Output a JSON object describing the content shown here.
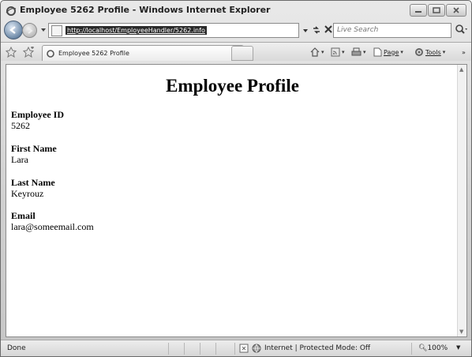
{
  "window": {
    "title": "Employee 5262 Profile - Windows Internet Explorer"
  },
  "address_bar": {
    "url": "http://localhost/EmployeeHandler/5262.info",
    "search_placeholder": "Live Search"
  },
  "tabs": [
    {
      "label": "Employee 5262 Profile"
    }
  ],
  "command_bar": {
    "page_label": "Page",
    "tools_label": "Tools"
  },
  "page": {
    "heading": "Employee Profile",
    "fields": [
      {
        "label": "Employee ID",
        "value": "5262"
      },
      {
        "label": "First Name",
        "value": "Lara"
      },
      {
        "label": "Last Name",
        "value": "Keyrouz"
      },
      {
        "label": "Email",
        "value": "lara@someemail.com"
      }
    ]
  },
  "status_bar": {
    "status": "Done",
    "zone": "Internet | Protected Mode: Off",
    "zoom": "100%"
  }
}
